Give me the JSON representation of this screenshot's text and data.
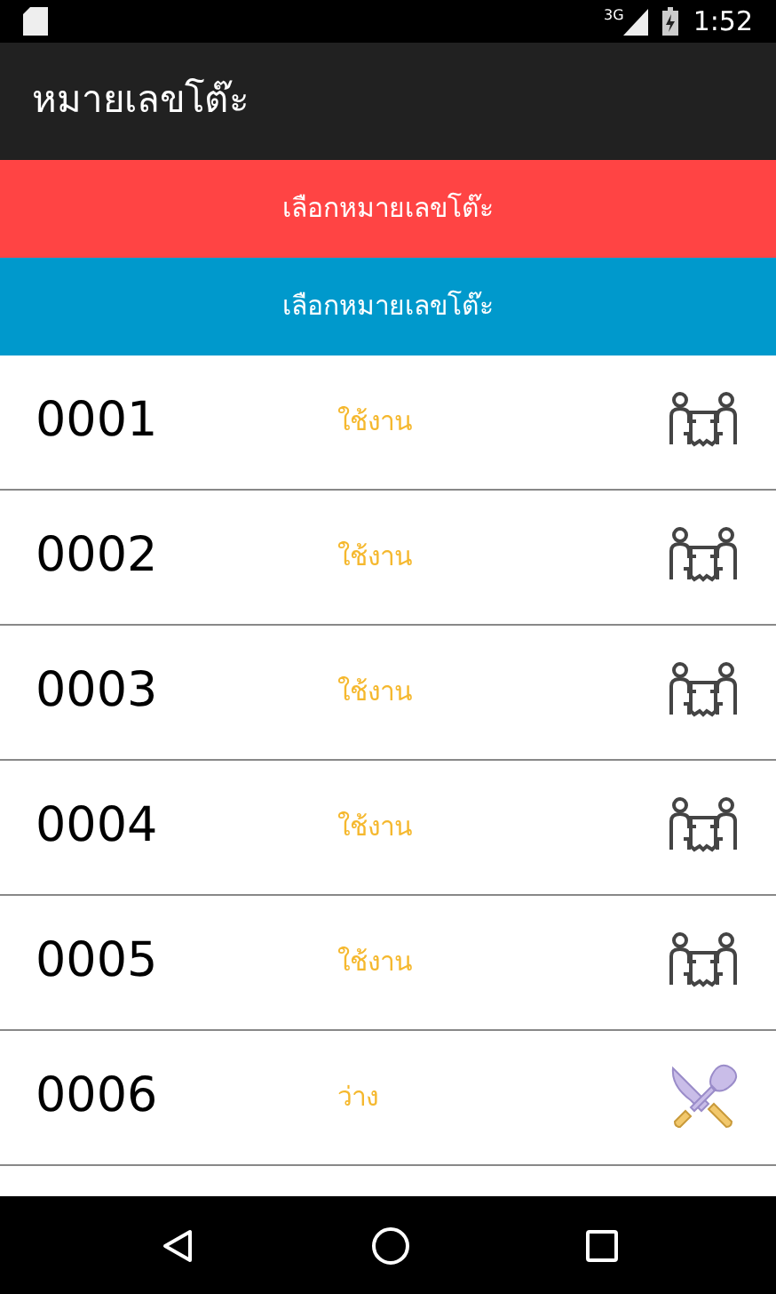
{
  "status_bar": {
    "network": "3G",
    "time": "1:52"
  },
  "app_bar": {
    "title": "หมายเลขโต๊ะ"
  },
  "buttons": [
    {
      "label": "เลือกหมายเลขโต๊ะ",
      "color": "#ff4444"
    },
    {
      "label": "เลือกหมายเลขโต๊ะ",
      "color": "#0099cc"
    }
  ],
  "tables": [
    {
      "number": "0001",
      "status": "ใช้งาน",
      "kind": "occupied"
    },
    {
      "number": "0002",
      "status": "ใช้งาน",
      "kind": "occupied"
    },
    {
      "number": "0003",
      "status": "ใช้งาน",
      "kind": "occupied"
    },
    {
      "number": "0004",
      "status": "ใช้งาน",
      "kind": "occupied"
    },
    {
      "number": "0005",
      "status": "ใช้งาน",
      "kind": "occupied"
    },
    {
      "number": "0006",
      "status": "ว่าง",
      "kind": "free"
    }
  ]
}
